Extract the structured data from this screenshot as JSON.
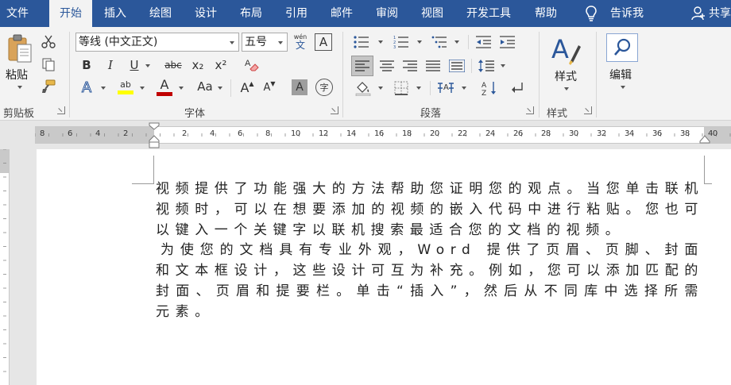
{
  "menubar": {
    "tabs": [
      "文件",
      "开始",
      "插入",
      "绘图",
      "设计",
      "布局",
      "引用",
      "邮件",
      "审阅",
      "视图",
      "开发工具",
      "帮助"
    ],
    "active_tab": "开始",
    "tell_me": "告诉我",
    "share": "共享"
  },
  "ribbon": {
    "clipboard": {
      "paste_label": "粘贴",
      "group_label": "剪贴板"
    },
    "font": {
      "font_name": "等线 (中文正文)",
      "font_size": "五号",
      "phonetic_label": "wén",
      "group_label": "字体",
      "bold": "B",
      "italic": "I",
      "underline": "U",
      "strike": "abc",
      "subscript": "x₂",
      "superscript": "x²",
      "font_color_letter": "A",
      "highlight_label": "ab",
      "case_label": "Aa",
      "grow": "A",
      "shrink": "A",
      "char_shade": "A",
      "enclose": "字"
    },
    "paragraph": {
      "group_label": "段落"
    },
    "styles": {
      "label": "样式",
      "group_label": "样式"
    },
    "editing": {
      "label": "编辑"
    }
  },
  "ruler": {
    "numbers": [
      "8",
      "6",
      "4",
      "2",
      "2",
      "4",
      "6",
      "8",
      "10",
      "12",
      "14",
      "16",
      "18",
      "20",
      "22",
      "24",
      "26",
      "28",
      "30",
      "32",
      "34",
      "36",
      "38",
      "40"
    ]
  },
  "document": {
    "paragraphs": [
      "视频提供了功能强大的方法帮助您证明您的观点。当您单击联机视频时，可以在想要添加的视频的嵌入代码中进行粘贴。您也可以键入一个关键字以联机搜索最适合您的文档的视频。",
      "为使您的文档具有专业外观，Word 提供了页眉、页脚、封面和文本框设计，这些设计可互为补充。例如，您可以添加匹配的封面、页眉和提要栏。单击“插入”，然后从不同库中选择所需元素。"
    ]
  },
  "colors": {
    "menubar_bg": "#2b579a",
    "ribbon_bg": "#f3f3f3",
    "font_color_bar": "#c00000",
    "highlight_bar": "#ffff00",
    "accent_blue": "#2b579a"
  }
}
